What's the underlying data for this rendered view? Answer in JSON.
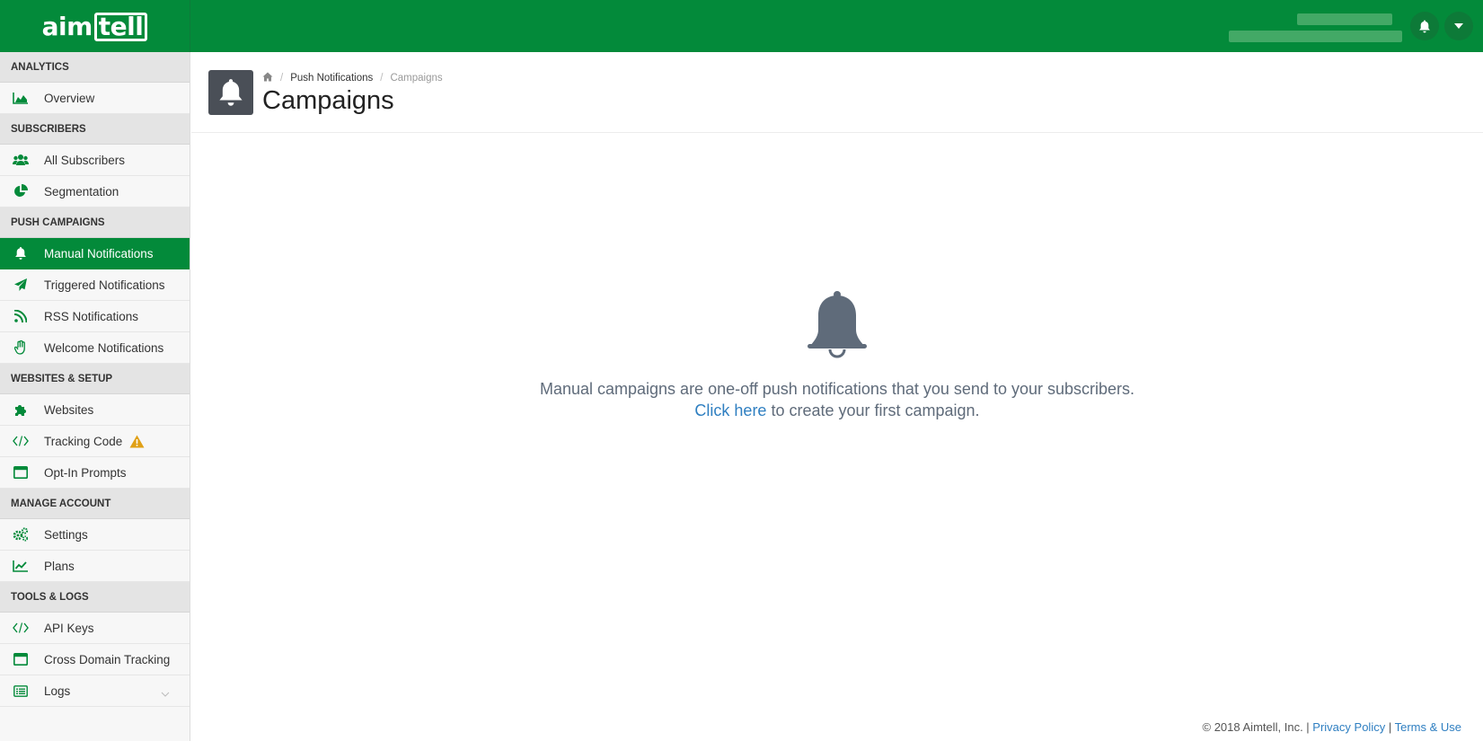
{
  "brand": {
    "logo_text_a": "aim",
    "logo_text_b": "tell"
  },
  "colors": {
    "brand_green": "#038a3a",
    "link_blue": "#2f7fc1",
    "icon_gray": "#5f6b7a"
  },
  "sidebar": {
    "sections": [
      {
        "title": "ANALYTICS",
        "items": [
          {
            "label": "Overview",
            "icon": "area-chart-icon"
          }
        ]
      },
      {
        "title": "SUBSCRIBERS",
        "items": [
          {
            "label": "All Subscribers",
            "icon": "users-icon"
          },
          {
            "label": "Segmentation",
            "icon": "pie-chart-icon"
          }
        ]
      },
      {
        "title": "PUSH CAMPAIGNS",
        "items": [
          {
            "label": "Manual Notifications",
            "icon": "bell-icon",
            "active": true
          },
          {
            "label": "Triggered Notifications",
            "icon": "paper-plane-icon"
          },
          {
            "label": "RSS Notifications",
            "icon": "rss-icon"
          },
          {
            "label": "Welcome Notifications",
            "icon": "hand-wave-icon"
          }
        ]
      },
      {
        "title": "WEBSITES & SETUP",
        "items": [
          {
            "label": "Websites",
            "icon": "puzzle-icon"
          },
          {
            "label": "Tracking Code",
            "icon": "code-icon",
            "warning": true
          },
          {
            "label": "Opt-In Prompts",
            "icon": "window-icon"
          }
        ]
      },
      {
        "title": "MANAGE ACCOUNT",
        "items": [
          {
            "label": "Settings",
            "icon": "gears-icon"
          },
          {
            "label": "Plans",
            "icon": "line-chart-icon"
          }
        ]
      },
      {
        "title": "TOOLS & LOGS",
        "items": [
          {
            "label": "API Keys",
            "icon": "code-icon"
          },
          {
            "label": "Cross Domain Tracking",
            "icon": "window-icon"
          },
          {
            "label": "Logs",
            "icon": "list-icon",
            "expandable": true
          }
        ]
      }
    ]
  },
  "breadcrumb": {
    "item1": "Push Notifications",
    "item2": "Campaigns"
  },
  "page": {
    "title": "Campaigns"
  },
  "empty_state": {
    "line1": "Manual campaigns are one-off push notifications that you send to your subscribers.",
    "link_text": "Click here",
    "line2_rest": " to create your first campaign."
  },
  "footer": {
    "copyright": "© 2018 Aimtell, Inc. | ",
    "privacy": "Privacy Policy",
    "sep": " | ",
    "terms": "Terms & Use"
  }
}
